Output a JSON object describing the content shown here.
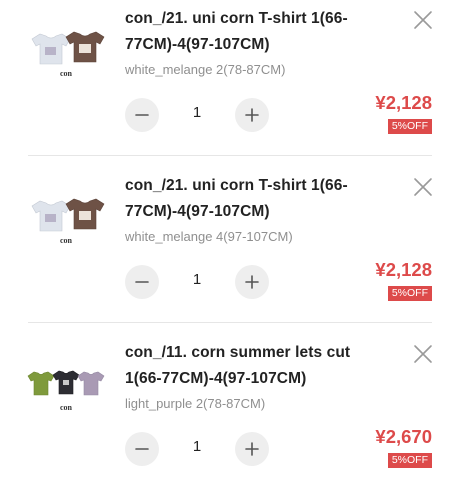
{
  "cart": {
    "items": [
      {
        "title": "con_/21. uni corn T-shirt 1(66-77CM)-4(97-107CM)",
        "variant": "white_melange 2(78-87CM)",
        "quantity": "1",
        "price": "¥2,128",
        "discount": "5%OFF",
        "thumb_brand": "con",
        "thumb_shirts": [
          "#dfe4ec",
          "#6e5246"
        ]
      },
      {
        "title": "con_/21. uni corn T-shirt 1(66-77CM)-4(97-107CM)",
        "variant": "white_melange 4(97-107CM)",
        "quantity": "1",
        "price": "¥2,128",
        "discount": "5%OFF",
        "thumb_brand": "con",
        "thumb_shirts": [
          "#dfe4ec",
          "#6e5246"
        ]
      },
      {
        "title": "con_/11. corn summer lets cut 1(66-77CM)-4(97-107CM)",
        "variant": "light_purple 2(78-87CM)",
        "quantity": "1",
        "price": "¥2,670",
        "discount": "5%OFF",
        "thumb_brand": "con",
        "thumb_shirts": [
          "#7f9a3c",
          "#2d2d33",
          "#a99ab4"
        ]
      }
    ]
  },
  "icons": {
    "remove": "close-icon",
    "decrement": "minus-icon",
    "increment": "plus-icon"
  },
  "colors": {
    "price": "#dd4a4a",
    "badge_bg": "#dd4a4a",
    "stepper_bg": "#eeeeee",
    "variant_text": "#8f8f8f",
    "divider": "#e6e6e6"
  }
}
